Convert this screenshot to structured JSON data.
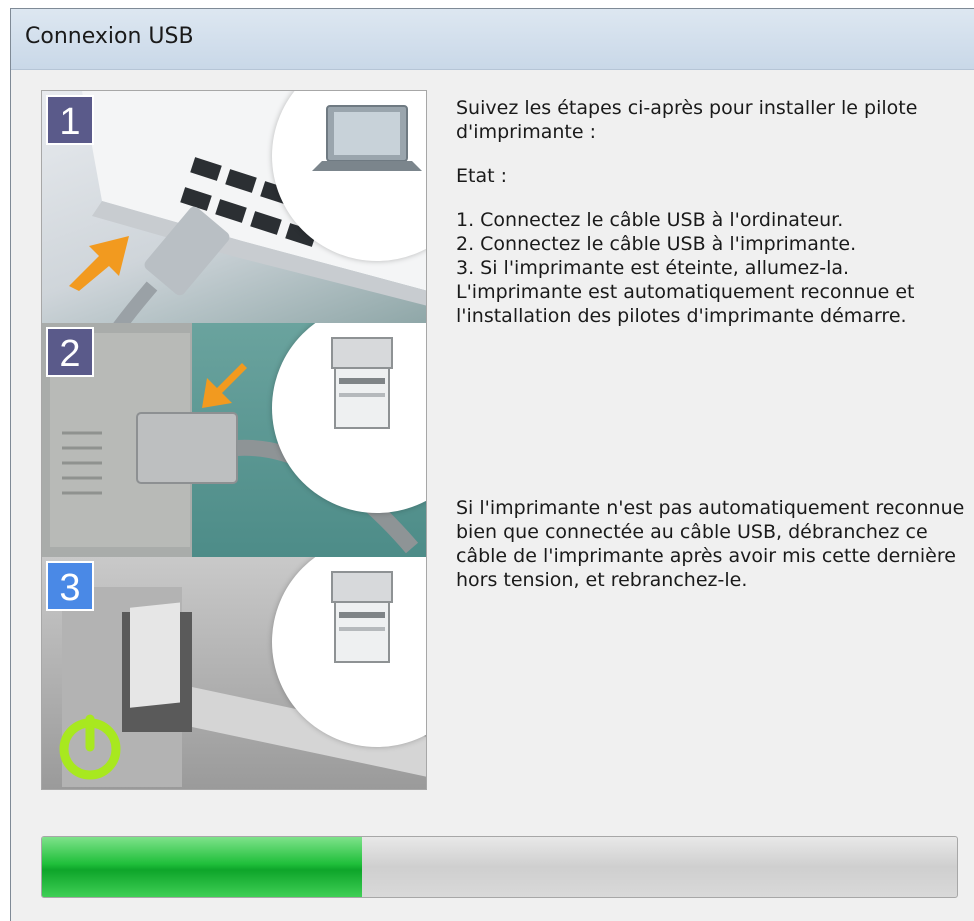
{
  "window": {
    "title": "Connexion USB"
  },
  "illustration": {
    "steps": [
      {
        "number": "1",
        "icon": "laptop-icon",
        "accent": "#5a5a8a"
      },
      {
        "number": "2",
        "icon": "printer-icon",
        "accent": "#5a5a8a"
      },
      {
        "number": "3",
        "icon": "printer-icon",
        "accent": "#4a89e6"
      }
    ],
    "power_icon": "power-icon"
  },
  "instructions": {
    "intro": "Suivez les étapes ci-après pour installer le pilote d'imprimante :",
    "state_label": "Etat :",
    "steps": [
      "1. Connectez le câble USB à l'ordinateur.",
      "2. Connectez le câble USB à l'imprimante.",
      "3. Si l'imprimante est éteinte, allumez-la."
    ],
    "auto_detect": "L'imprimante est automatiquement reconnue et l'installation des pilotes d'imprimante démarre.",
    "note": "Si l'imprimante n'est pas automatiquement reconnue bien que connectée au câble USB, débranchez ce câble de l'imprimante après avoir mis cette dernière hors tension, et rebranchez-le."
  },
  "progress": {
    "value": 0.35,
    "color": "#1fbf3a"
  }
}
